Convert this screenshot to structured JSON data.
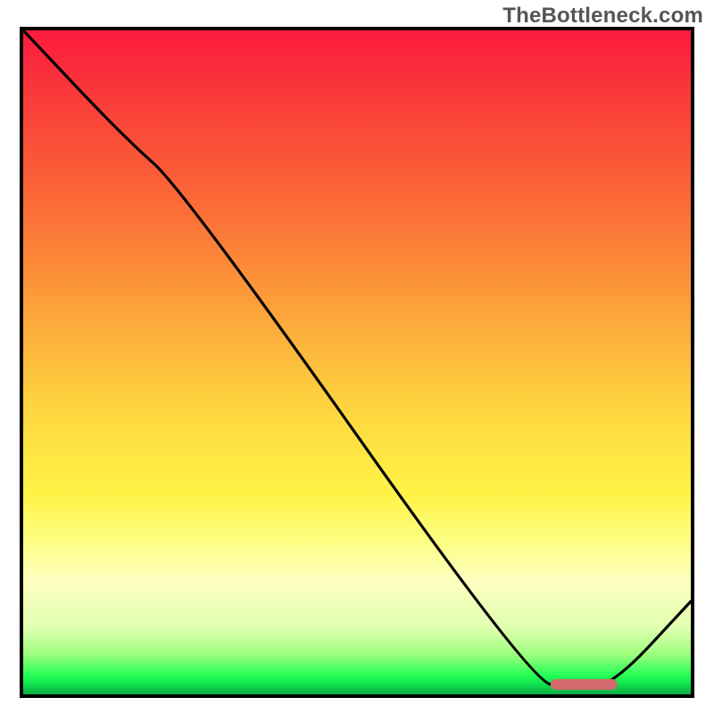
{
  "watermark": "TheBottleneck.com",
  "chart_data": {
    "type": "line",
    "title": "",
    "xlabel": "",
    "ylabel": "",
    "xlim": [
      0,
      100
    ],
    "ylim": [
      0,
      100
    ],
    "grid": false,
    "legend": false,
    "series": [
      {
        "name": "curve",
        "x": [
          0,
          15,
          24,
          76,
          82,
          88,
          100
        ],
        "y": [
          100,
          84,
          76,
          2,
          1,
          1,
          14
        ],
        "notes": "y expressed as percent of plot height from bottom; single black curve descending steeply, flattening near bottom ~x=80–88, then rising toward right edge"
      }
    ],
    "marker": {
      "name": "optimum-band",
      "x_range": [
        79,
        89
      ],
      "y": 1.5,
      "color": "#d26a6e",
      "shape": "rounded-bar"
    },
    "background_gradient": {
      "top": "#fb1a3e",
      "mid_upper": "#fca23a",
      "mid": "#fff347",
      "mid_lower": "#fdffc0",
      "bottom": "#0bab46"
    }
  }
}
